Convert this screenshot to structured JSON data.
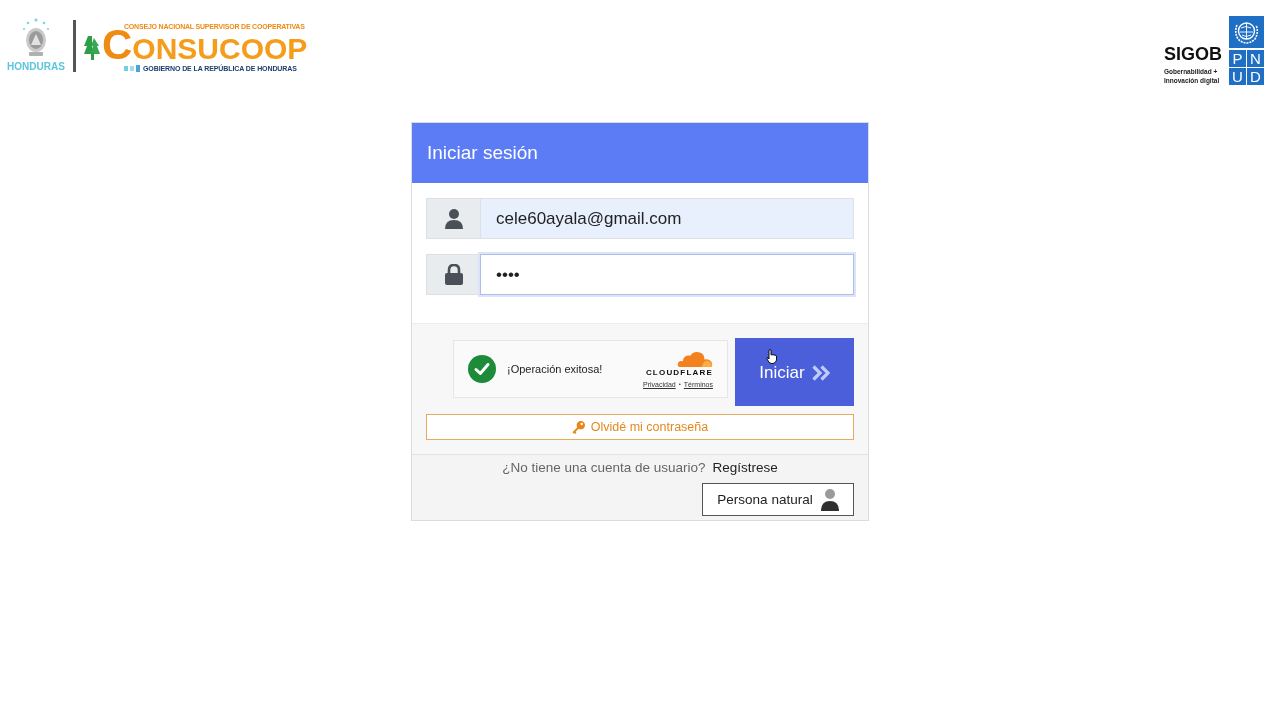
{
  "header": {
    "left_logo": {
      "country": "HONDURAS",
      "org_tagline": "CONSEJO NACIONAL SUPERVISOR DE COOPERATIVAS",
      "org_name": "CONSUCOOP",
      "government": "GOBIERNO DE LA REPÚBLICA DE HONDURAS"
    },
    "right_logo": {
      "name": "SIGOB",
      "tagline_lines": [
        "Gobernabilidad +",
        "Innovación digital"
      ],
      "partner_letters": [
        "P",
        "N",
        "U",
        "D"
      ]
    }
  },
  "login": {
    "title": "Iniciar sesión",
    "fields": [
      {
        "kind": "email",
        "value": "cele60ayala@gmail.com",
        "focused": false,
        "autofilled": true
      },
      {
        "kind": "password",
        "value": "••••",
        "focused": true,
        "autofilled": false
      }
    ],
    "captcha": {
      "success": true,
      "status": "¡Operación exitosa!",
      "brand": "CLOUDFLARE",
      "links": [
        "Privacidad",
        "Términos"
      ],
      "link_separator": "•"
    },
    "submit_button": "Iniciar",
    "forgot_password": "Olvidé mi contraseña",
    "register": {
      "prompt": "¿No tiene una cuenta de usuario?",
      "link": "Regístrese"
    },
    "account_type_button": "Persona natural"
  }
}
